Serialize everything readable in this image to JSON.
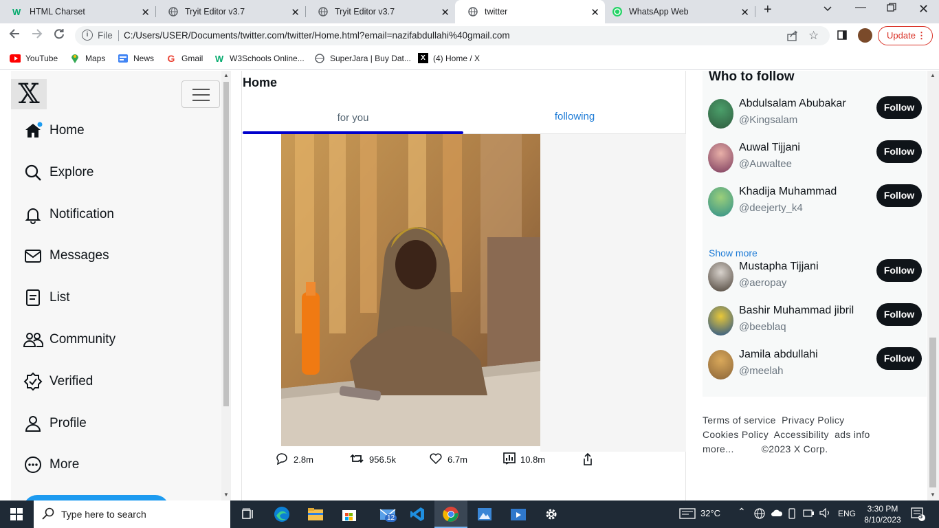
{
  "browser": {
    "tabs": [
      {
        "title": "HTML Charset",
        "favicon": "w3schools-icon"
      },
      {
        "title": "Tryit Editor v3.7",
        "favicon": "globe-icon"
      },
      {
        "title": "Tryit Editor v3.7",
        "favicon": "globe-icon"
      },
      {
        "title": "twitter",
        "favicon": "globe-icon",
        "active": true
      },
      {
        "title": "WhatsApp Web",
        "favicon": "whatsapp-icon"
      }
    ],
    "address": {
      "scheme_label": "File",
      "url": "C:/Users/USER/Documents/twitter.com/twitter/Home.html?email=nazifabdullahi%40gmail.com"
    },
    "update_label": "Update",
    "bookmarks": [
      "YouTube",
      "Maps",
      "News",
      "Gmail",
      "W3Schools Online...",
      "SuperJara | Buy Dat...",
      "(4) Home / X"
    ]
  },
  "sidebar": {
    "items": [
      {
        "label": "Home",
        "icon": "home-icon"
      },
      {
        "label": "Explore",
        "icon": "search-icon"
      },
      {
        "label": "Notification",
        "icon": "bell-icon"
      },
      {
        "label": "Messages",
        "icon": "envelope-icon"
      },
      {
        "label": "List",
        "icon": "list-icon"
      },
      {
        "label": "Community",
        "icon": "people-icon"
      },
      {
        "label": "Verified",
        "icon": "verified-badge-icon"
      },
      {
        "label": "Profile",
        "icon": "person-icon"
      },
      {
        "label": "More",
        "icon": "more-circle-icon"
      }
    ]
  },
  "main": {
    "title": "Home",
    "tabs": {
      "for_you": "for you",
      "following": "following"
    },
    "post": {
      "stats": {
        "replies": "2.8m",
        "reposts": "956.5k",
        "likes": "6.7m",
        "views": "10.8m"
      }
    }
  },
  "who_to_follow": {
    "title": "Who to follow",
    "follow_label": "Follow",
    "show_more": "Show more",
    "people": [
      {
        "name": "Abdulsalam Abubakar",
        "handle": "@Kingsalam"
      },
      {
        "name": "Auwal Tijjani",
        "handle": "@Auwaltee"
      },
      {
        "name": "Khadija Muhammad",
        "handle": "@deejerty_k4"
      },
      {
        "name": "Mustapha Tijjani",
        "handle": "@aeropay"
      },
      {
        "name": "Bashir Muhammad jibril",
        "handle": "@beeblaq"
      },
      {
        "name": "Jamila abdullahi",
        "handle": "@meelah"
      }
    ]
  },
  "footer": {
    "terms": "Terms of service",
    "privacy": "Privacy Policy",
    "cookies": "Cookies Policy",
    "accessibility": "Accessibility",
    "ads": "ads info",
    "more": "more...",
    "copyright": "©2023 X Corp."
  },
  "taskbar": {
    "search_placeholder": "Type here to search",
    "weather": "32°C",
    "language": "ENG",
    "time": "3:30 PM",
    "date": "8/10/2023",
    "mail_badge": "12",
    "notification_count": "5"
  }
}
